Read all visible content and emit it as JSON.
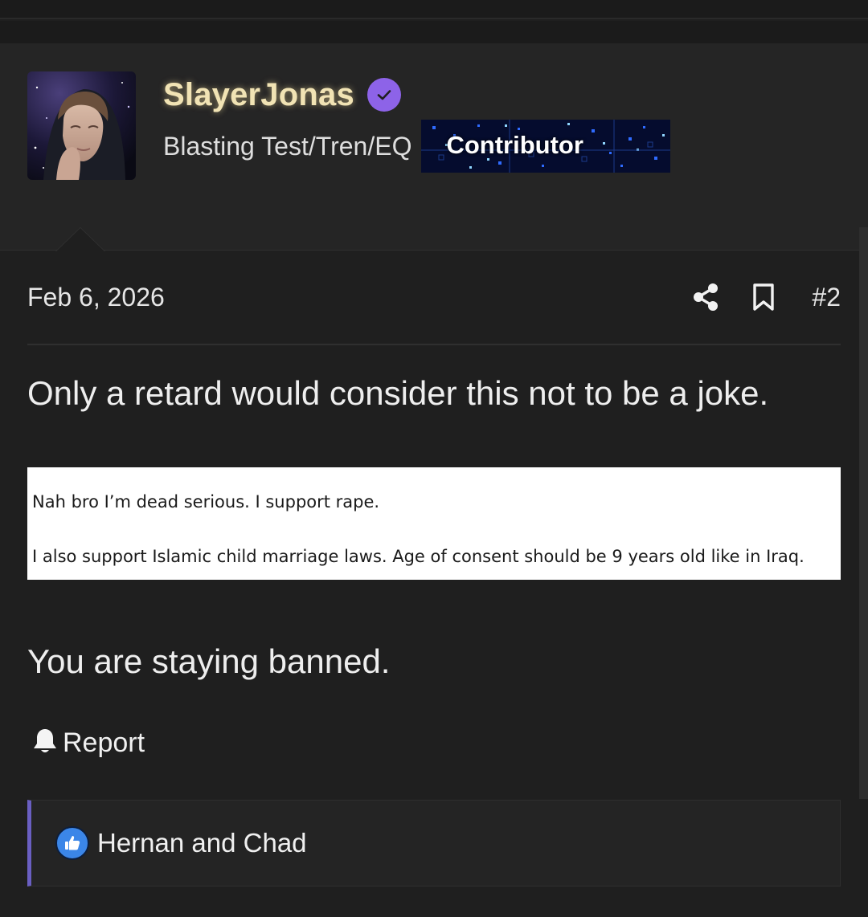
{
  "user": {
    "username": "SlayerJonas",
    "user_title": "Blasting Test/Tren/EQ",
    "role_badge": "Contributor"
  },
  "post": {
    "date": "Feb 6, 2026",
    "number": "#2",
    "body_line_1": "Only a retard would consider this not to be a joke.",
    "quoted_image_line_1": "Nah bro I’m dead serious. I support rape.",
    "quoted_image_line_2": "I also support Islamic child marriage laws. Age of consent should be 9 years old like in Iraq.",
    "body_line_2": "You are staying banned."
  },
  "actions": {
    "report_label": "Report"
  },
  "reactions": {
    "users_text": "Hernan and Chad"
  },
  "colors": {
    "background": "#1f1f1f",
    "user_block": "#252525",
    "username": "#f1e3b4",
    "verified_badge": "#8d63e8",
    "role_badge_bg": "#050c2e",
    "reaction_accent": "#6a5fc2",
    "like_icon": "#3b86e8"
  },
  "icons": {
    "verified": "check-circle-icon",
    "share": "share-icon",
    "bookmark": "bookmark-icon",
    "report": "bell-icon",
    "like": "thumbs-up-icon"
  }
}
